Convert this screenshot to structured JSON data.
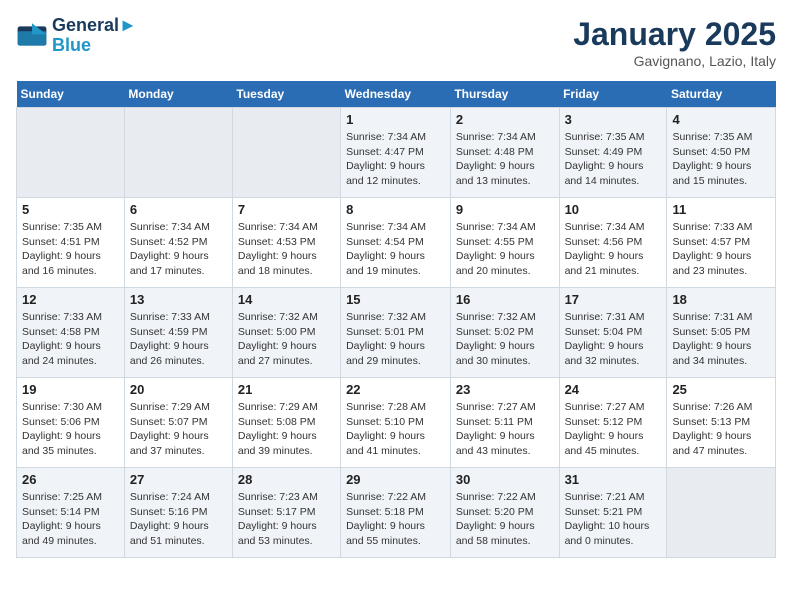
{
  "logo": {
    "line1": "General",
    "line2": "Blue"
  },
  "title": "January 2025",
  "location": "Gavignano, Lazio, Italy",
  "weekdays": [
    "Sunday",
    "Monday",
    "Tuesday",
    "Wednesday",
    "Thursday",
    "Friday",
    "Saturday"
  ],
  "weeks": [
    [
      {
        "day": "",
        "sunrise": "",
        "sunset": "",
        "daylight": ""
      },
      {
        "day": "",
        "sunrise": "",
        "sunset": "",
        "daylight": ""
      },
      {
        "day": "",
        "sunrise": "",
        "sunset": "",
        "daylight": ""
      },
      {
        "day": "1",
        "sunrise": "Sunrise: 7:34 AM",
        "sunset": "Sunset: 4:47 PM",
        "daylight": "Daylight: 9 hours and 12 minutes."
      },
      {
        "day": "2",
        "sunrise": "Sunrise: 7:34 AM",
        "sunset": "Sunset: 4:48 PM",
        "daylight": "Daylight: 9 hours and 13 minutes."
      },
      {
        "day": "3",
        "sunrise": "Sunrise: 7:35 AM",
        "sunset": "Sunset: 4:49 PM",
        "daylight": "Daylight: 9 hours and 14 minutes."
      },
      {
        "day": "4",
        "sunrise": "Sunrise: 7:35 AM",
        "sunset": "Sunset: 4:50 PM",
        "daylight": "Daylight: 9 hours and 15 minutes."
      }
    ],
    [
      {
        "day": "5",
        "sunrise": "Sunrise: 7:35 AM",
        "sunset": "Sunset: 4:51 PM",
        "daylight": "Daylight: 9 hours and 16 minutes."
      },
      {
        "day": "6",
        "sunrise": "Sunrise: 7:34 AM",
        "sunset": "Sunset: 4:52 PM",
        "daylight": "Daylight: 9 hours and 17 minutes."
      },
      {
        "day": "7",
        "sunrise": "Sunrise: 7:34 AM",
        "sunset": "Sunset: 4:53 PM",
        "daylight": "Daylight: 9 hours and 18 minutes."
      },
      {
        "day": "8",
        "sunrise": "Sunrise: 7:34 AM",
        "sunset": "Sunset: 4:54 PM",
        "daylight": "Daylight: 9 hours and 19 minutes."
      },
      {
        "day": "9",
        "sunrise": "Sunrise: 7:34 AM",
        "sunset": "Sunset: 4:55 PM",
        "daylight": "Daylight: 9 hours and 20 minutes."
      },
      {
        "day": "10",
        "sunrise": "Sunrise: 7:34 AM",
        "sunset": "Sunset: 4:56 PM",
        "daylight": "Daylight: 9 hours and 21 minutes."
      },
      {
        "day": "11",
        "sunrise": "Sunrise: 7:33 AM",
        "sunset": "Sunset: 4:57 PM",
        "daylight": "Daylight: 9 hours and 23 minutes."
      }
    ],
    [
      {
        "day": "12",
        "sunrise": "Sunrise: 7:33 AM",
        "sunset": "Sunset: 4:58 PM",
        "daylight": "Daylight: 9 hours and 24 minutes."
      },
      {
        "day": "13",
        "sunrise": "Sunrise: 7:33 AM",
        "sunset": "Sunset: 4:59 PM",
        "daylight": "Daylight: 9 hours and 26 minutes."
      },
      {
        "day": "14",
        "sunrise": "Sunrise: 7:32 AM",
        "sunset": "Sunset: 5:00 PM",
        "daylight": "Daylight: 9 hours and 27 minutes."
      },
      {
        "day": "15",
        "sunrise": "Sunrise: 7:32 AM",
        "sunset": "Sunset: 5:01 PM",
        "daylight": "Daylight: 9 hours and 29 minutes."
      },
      {
        "day": "16",
        "sunrise": "Sunrise: 7:32 AM",
        "sunset": "Sunset: 5:02 PM",
        "daylight": "Daylight: 9 hours and 30 minutes."
      },
      {
        "day": "17",
        "sunrise": "Sunrise: 7:31 AM",
        "sunset": "Sunset: 5:04 PM",
        "daylight": "Daylight: 9 hours and 32 minutes."
      },
      {
        "day": "18",
        "sunrise": "Sunrise: 7:31 AM",
        "sunset": "Sunset: 5:05 PM",
        "daylight": "Daylight: 9 hours and 34 minutes."
      }
    ],
    [
      {
        "day": "19",
        "sunrise": "Sunrise: 7:30 AM",
        "sunset": "Sunset: 5:06 PM",
        "daylight": "Daylight: 9 hours and 35 minutes."
      },
      {
        "day": "20",
        "sunrise": "Sunrise: 7:29 AM",
        "sunset": "Sunset: 5:07 PM",
        "daylight": "Daylight: 9 hours and 37 minutes."
      },
      {
        "day": "21",
        "sunrise": "Sunrise: 7:29 AM",
        "sunset": "Sunset: 5:08 PM",
        "daylight": "Daylight: 9 hours and 39 minutes."
      },
      {
        "day": "22",
        "sunrise": "Sunrise: 7:28 AM",
        "sunset": "Sunset: 5:10 PM",
        "daylight": "Daylight: 9 hours and 41 minutes."
      },
      {
        "day": "23",
        "sunrise": "Sunrise: 7:27 AM",
        "sunset": "Sunset: 5:11 PM",
        "daylight": "Daylight: 9 hours and 43 minutes."
      },
      {
        "day": "24",
        "sunrise": "Sunrise: 7:27 AM",
        "sunset": "Sunset: 5:12 PM",
        "daylight": "Daylight: 9 hours and 45 minutes."
      },
      {
        "day": "25",
        "sunrise": "Sunrise: 7:26 AM",
        "sunset": "Sunset: 5:13 PM",
        "daylight": "Daylight: 9 hours and 47 minutes."
      }
    ],
    [
      {
        "day": "26",
        "sunrise": "Sunrise: 7:25 AM",
        "sunset": "Sunset: 5:14 PM",
        "daylight": "Daylight: 9 hours and 49 minutes."
      },
      {
        "day": "27",
        "sunrise": "Sunrise: 7:24 AM",
        "sunset": "Sunset: 5:16 PM",
        "daylight": "Daylight: 9 hours and 51 minutes."
      },
      {
        "day": "28",
        "sunrise": "Sunrise: 7:23 AM",
        "sunset": "Sunset: 5:17 PM",
        "daylight": "Daylight: 9 hours and 53 minutes."
      },
      {
        "day": "29",
        "sunrise": "Sunrise: 7:22 AM",
        "sunset": "Sunset: 5:18 PM",
        "daylight": "Daylight: 9 hours and 55 minutes."
      },
      {
        "day": "30",
        "sunrise": "Sunrise: 7:22 AM",
        "sunset": "Sunset: 5:20 PM",
        "daylight": "Daylight: 9 hours and 58 minutes."
      },
      {
        "day": "31",
        "sunrise": "Sunrise: 7:21 AM",
        "sunset": "Sunset: 5:21 PM",
        "daylight": "Daylight: 10 hours and 0 minutes."
      },
      {
        "day": "",
        "sunrise": "",
        "sunset": "",
        "daylight": ""
      }
    ]
  ]
}
